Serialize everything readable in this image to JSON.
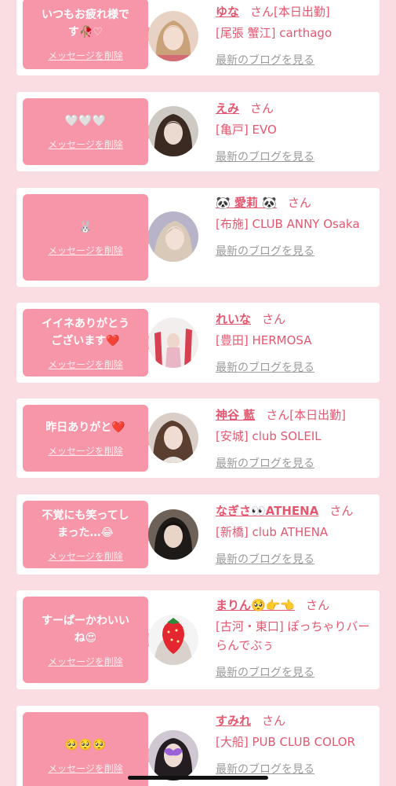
{
  "cards": [
    {
      "message": "いつもお疲れ様で\nす🥀♡",
      "delete_label": "メッセージを削除",
      "name": "ゆな",
      "honorific": "さん[本日出勤]",
      "shop": "[尾張 蟹江] carthago",
      "blog_label": "最新のブログを見る",
      "avatar": "avatar-blonde"
    },
    {
      "message": "🤍🤍🤍",
      "delete_label": "メッセージを削除",
      "name": "えみ",
      "honorific": "さん",
      "shop": "[亀戸] EVO",
      "blog_label": "最新のブログを見る",
      "avatar": "avatar-dark"
    },
    {
      "message": "🐰",
      "delete_label": "メッセージを削除",
      "name": "🐼 愛莉 🐼",
      "honorific": "さん",
      "shop": "[布施] CLUB ANNY Osaka",
      "blog_label": "最新のブログを見る",
      "avatar": "avatar-light"
    },
    {
      "message": "イイネありがとう\nございます❤️",
      "delete_label": "メッセージを削除",
      "name": "れいな",
      "honorific": "さん",
      "shop": "[豊田] HERMOSA",
      "blog_label": "最新のブログを見る",
      "avatar": "avatar-red"
    },
    {
      "message": "昨日ありがと❤️",
      "delete_label": "メッセージを削除",
      "name": "神谷 藍",
      "honorific": "さん[本日出勤]",
      "shop": "[安城] club SOLEIL",
      "blog_label": "最新のブログを見る",
      "avatar": "avatar-brown"
    },
    {
      "message": "不覚にも笑ってし\nまった…😂",
      "delete_label": "メッセージを削除",
      "name": "なぎさ👀ATHENA",
      "honorific": "さん",
      "shop": "[新橋] club ATHENA",
      "blog_label": "最新のブログを見る",
      "avatar": "avatar-black"
    },
    {
      "message": "すーぱーかわいい\nね😍",
      "delete_label": "メッセージを削除",
      "name": "まりん🥺👉👈",
      "honorific": "さん",
      "shop": "[古河・東口] ぽっちゃりバー らんでぶぅ",
      "blog_label": "最新のブログを見る",
      "avatar": "avatar-strawberry"
    },
    {
      "message": "🥺🥺🥺",
      "delete_label": "メッセージを削除",
      "name": "すみれ",
      "honorific": "さん",
      "shop": "[大船] PUB CLUB COLOR",
      "blog_label": "最新のブログを見る",
      "avatar": "avatar-purple"
    }
  ],
  "colors": {
    "background": "#f9dde3",
    "bubble": "#f796a8",
    "accent_text": "#e5566f",
    "muted_text": "#9a9a9a"
  }
}
